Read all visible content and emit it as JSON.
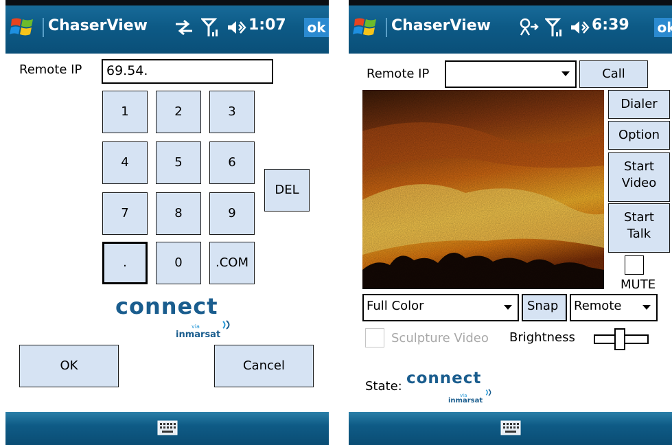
{
  "screen1": {
    "app_title": "ChaserView",
    "time": "1:07",
    "ok_label": "ok",
    "remote_ip_label": "Remote IP",
    "remote_ip_value": "69.54.",
    "keys": [
      "1",
      "2",
      "3",
      "4",
      "5",
      "6",
      "7",
      "8",
      "9",
      ".",
      "0",
      ".COM"
    ],
    "del_label": "DEL",
    "ok_button": "OK",
    "cancel_button": "Cancel",
    "logo_connect": "connect",
    "logo_via": "via",
    "logo_inmarsat": "inmarsat"
  },
  "screen2": {
    "app_title": "ChaserView",
    "time": "6:39",
    "ok_label": "ok",
    "remote_ip_label": "Remote IP",
    "call_button": "Call",
    "dialer_button": "Dialer",
    "option_button": "Option",
    "start_video_line1": "Start",
    "start_video_line2": "Video",
    "start_talk_line1": "Start",
    "start_talk_line2": "Talk",
    "mute_label": "MUTE",
    "color_mode_value": "Full Color",
    "snap_button": "Snap",
    "source_value": "Remote",
    "sculpture_label": "Sculpture Video",
    "brightness_label": "Brightness",
    "state_label": "State:",
    "logo_connect": "connect",
    "logo_via": "via",
    "logo_inmarsat": "inmarsat"
  }
}
